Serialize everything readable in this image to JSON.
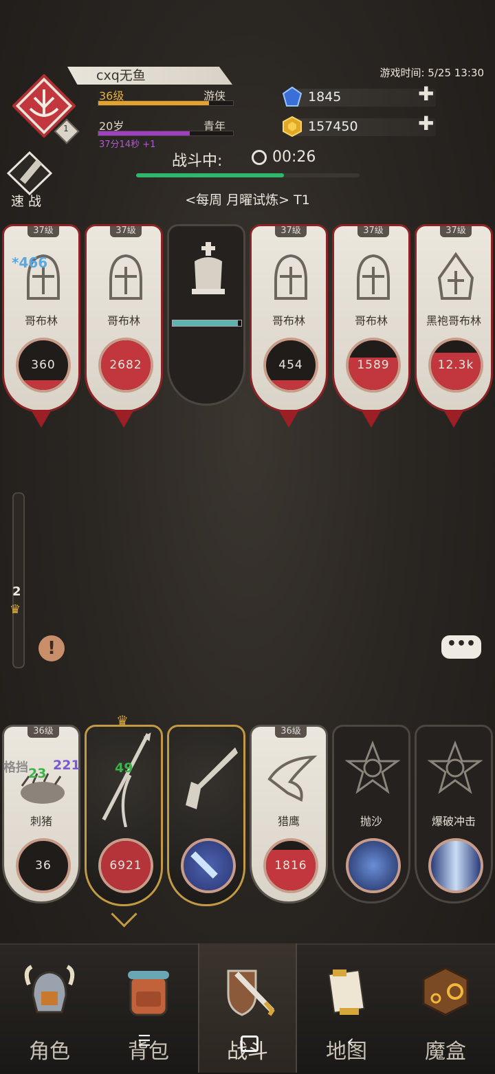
{
  "player": {
    "name": "cxq无鱼",
    "level_label": "36级",
    "class_label": "游侠",
    "level_progress": 0.82,
    "age_label": "20岁",
    "stage_label": "青年",
    "age_progress": 0.68,
    "age_sub": "37分14秒 +1",
    "badge": "1"
  },
  "game_time": "游戏时间: 5/25 13:30",
  "resources": {
    "gems": "1845",
    "gold": "157450"
  },
  "battle": {
    "status_label": "战斗中:",
    "timer": "00:26",
    "progress": 0.66,
    "quick_label": "速战",
    "stage_title": "<每周 月曜试炼> T1"
  },
  "enemies": [
    {
      "level": "37级",
      "name": "哥布林",
      "hp": "360",
      "hp_frac": 0.2,
      "float": "*466"
    },
    {
      "level": "37级",
      "name": "哥布林",
      "hp": "2682",
      "hp_frac": 1.0,
      "float": ""
    },
    {
      "level": "",
      "name": "",
      "hp": "",
      "hp_frac": 0.95,
      "float": ""
    },
    {
      "level": "37级",
      "name": "哥布林",
      "hp": "454",
      "hp_frac": 0.2,
      "float": ""
    },
    {
      "level": "37级",
      "name": "哥布林",
      "hp": "1589",
      "hp_frac": 0.65,
      "float": ""
    },
    {
      "level": "37级",
      "name": "黑袍哥布林",
      "hp": "12.3k",
      "hp_frac": 0.75,
      "float": ""
    }
  ],
  "allies": [
    {
      "level": "36级",
      "name": "刺猪",
      "hp": "36",
      "float": "23",
      "float2": "格挡",
      "float3": "221"
    },
    {
      "level": "",
      "name": "",
      "hp": "6921",
      "float": "49"
    },
    {
      "level": "",
      "name": "",
      "hp": "",
      "float": ""
    },
    {
      "level": "36级",
      "name": "猎鹰",
      "hp": "1816",
      "float": ""
    },
    {
      "level": "",
      "name": "抛沙",
      "hp": "",
      "float": ""
    },
    {
      "level": "",
      "name": "爆破冲击",
      "hp": "",
      "float": ""
    }
  ],
  "side": {
    "wave_num": "2"
  },
  "nav": [
    {
      "label": "角色",
      "icon": "helmet-icon"
    },
    {
      "label": "背包",
      "icon": "backpack-icon"
    },
    {
      "label": "战斗",
      "icon": "sword-shield-icon"
    },
    {
      "label": "地图",
      "icon": "scroll-icon"
    },
    {
      "label": "魔盒",
      "icon": "magic-box-icon"
    }
  ],
  "colors": {
    "accent_red": "#c2373d",
    "gold": "#e6b23a",
    "purple": "#b05ad0",
    "green": "#2fb86b"
  }
}
